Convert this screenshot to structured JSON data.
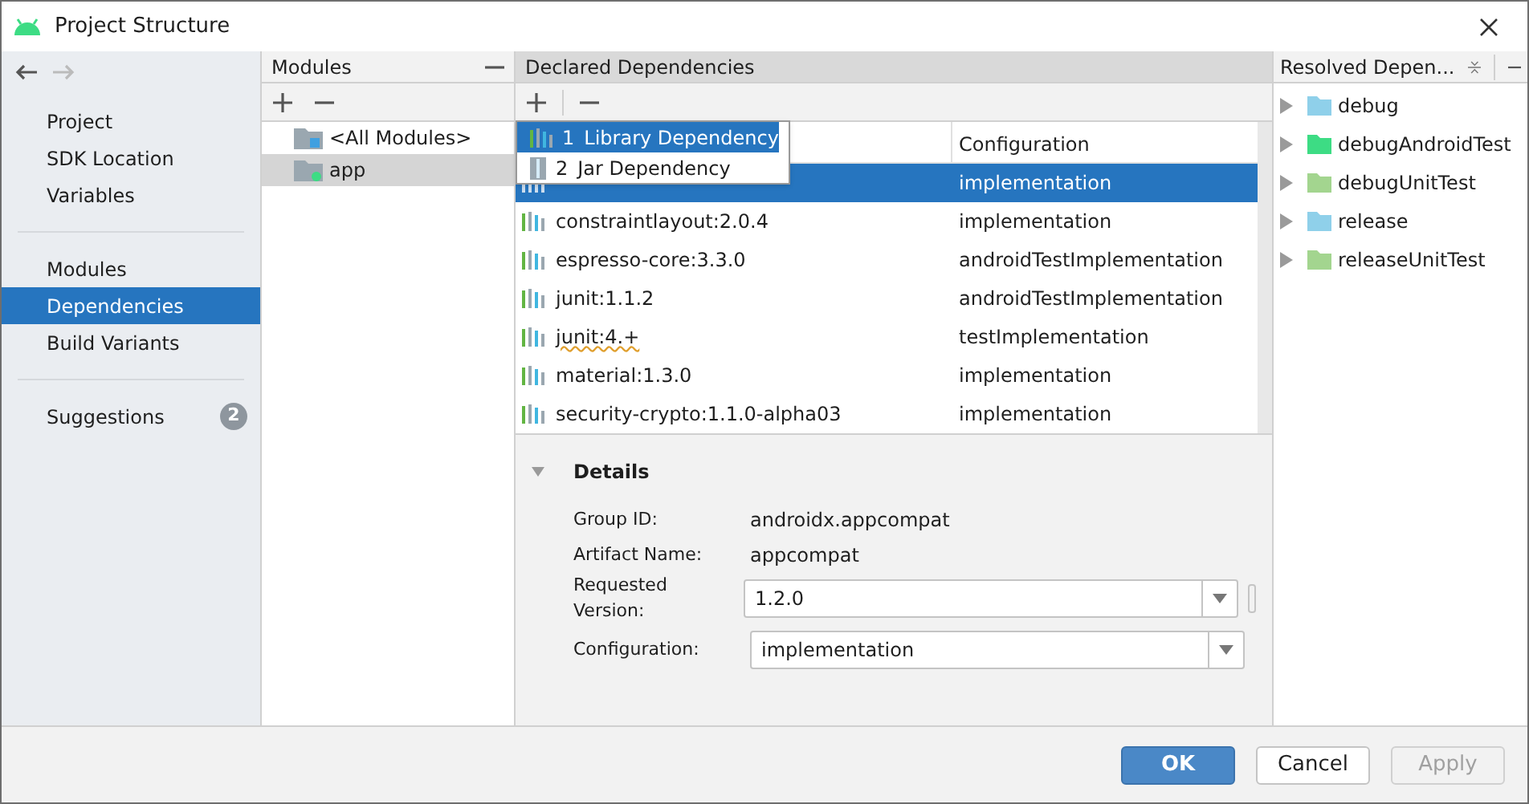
{
  "window": {
    "title": "Project Structure"
  },
  "sidebar": {
    "items": [
      {
        "label": "Project",
        "selected": false
      },
      {
        "label": "SDK Location",
        "selected": false
      },
      {
        "label": "Variables",
        "selected": false
      },
      {
        "kind": "divider"
      },
      {
        "label": "Modules",
        "selected": false
      },
      {
        "label": "Dependencies",
        "selected": true
      },
      {
        "label": "Build Variants",
        "selected": false
      },
      {
        "kind": "divider"
      },
      {
        "label": "Suggestions",
        "selected": false,
        "badge": "2"
      }
    ]
  },
  "modules": {
    "title": "Modules",
    "items": [
      {
        "label": "<All Modules>",
        "kind": "all",
        "selected": false
      },
      {
        "label": "app",
        "kind": "module",
        "selected": true
      }
    ]
  },
  "declared": {
    "title": "Declared Dependencies",
    "columns": [
      "Configuration"
    ],
    "rows": [
      {
        "configuration": "implementation",
        "selected": true
      },
      {
        "name": "constraintlayout:2.0.4",
        "configuration": "implementation",
        "selected": false
      },
      {
        "name": "espresso-core:3.3.0",
        "configuration": "androidTestImplementation",
        "selected": false
      },
      {
        "name": "junit:1.1.2",
        "configuration": "androidTestImplementation",
        "selected": false
      },
      {
        "name": "junit:4.+",
        "configuration": "testImplementation",
        "selected": false,
        "warning": true
      },
      {
        "name": "material:1.3.0",
        "configuration": "implementation",
        "selected": false
      },
      {
        "name": "security-crypto:1.1.0-alpha03",
        "configuration": "implementation",
        "selected": false
      }
    ],
    "popup": [
      {
        "number": "1",
        "label": "Library Dependency",
        "kind": "library",
        "selected": true
      },
      {
        "number": "2",
        "label": "Jar Dependency",
        "kind": "jar",
        "selected": false
      }
    ],
    "details": {
      "title": "Details",
      "fields": [
        {
          "label": "Group ID:",
          "value": "androidx.appcompat",
          "kind": "text"
        },
        {
          "label": "Artifact Name:",
          "value": "appcompat",
          "kind": "text"
        },
        {
          "label": "Requested Version:",
          "value": "1.2.0",
          "kind": "combo"
        },
        {
          "label": "Configuration:",
          "value": "implementation",
          "kind": "combo"
        }
      ]
    }
  },
  "resolved": {
    "title": "Resolved Depen...",
    "items": [
      {
        "label": "debug",
        "color": "#8fd0ea"
      },
      {
        "label": "debugAndroidTest",
        "color": "#3ddc84"
      },
      {
        "label": "debugUnitTest",
        "color": "#a3d58f"
      },
      {
        "label": "release",
        "color": "#8fd0ea"
      },
      {
        "label": "releaseUnitTest",
        "color": "#a3d58f"
      }
    ]
  },
  "buttons": [
    {
      "label": "OK",
      "kind": "primary"
    },
    {
      "label": "Cancel",
      "kind": "normal"
    },
    {
      "label": "Apply",
      "kind": "disabled"
    }
  ]
}
